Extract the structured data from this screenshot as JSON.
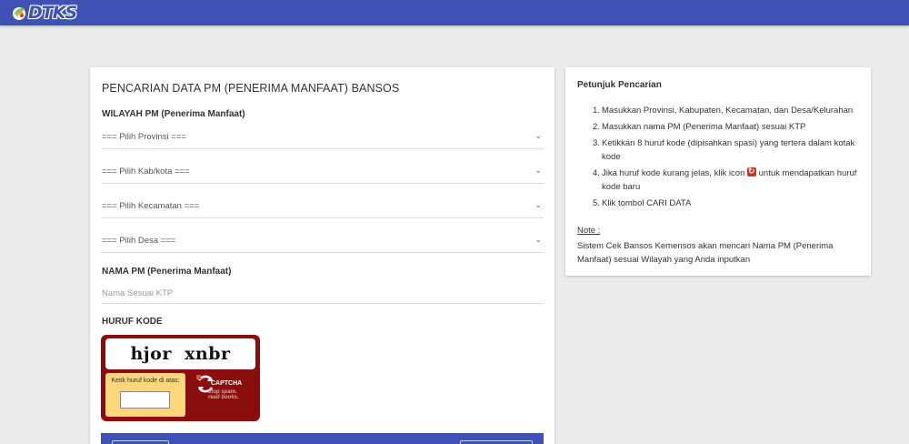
{
  "header": {
    "logo_text": "DTKS",
    "bar_color": "#3f51b5"
  },
  "form": {
    "title": "PENCARIAN DATA PM (PENERIMA MANFAAT) BANSOS",
    "wilayah_label": "WILAYAH PM (Penerima Manfaat)",
    "provinsi": "=== Pilih Provinsi ===",
    "kabkota": "=== Pilih Kab/kota ===",
    "kecamatan": "=== Pilih Kecamatan ===",
    "desa": "=== Pilih Desa ===",
    "nama_label": "NAMA PM (Penerima Manfaat)",
    "nama_placeholder": "Nama Sesuai KTP",
    "huruf_kode_label": "HURUF KODE"
  },
  "captcha": {
    "words": "hjor  xnbr",
    "input_label": "Ketik huruf kode di atas:",
    "brand": "CAPTCHA",
    "tagline_1": "stop spam.",
    "tagline_2": "read books.",
    "bg_color": "#8b0e0e"
  },
  "instructions": {
    "title": "Petunjuk Pencarian",
    "steps": [
      {
        "num": "1.",
        "text": "Masukkan Provinsi, Kabupaten, Kecamatan, dan Desa/Kelurahan"
      },
      {
        "num": "2.",
        "text": "Masukkan nama PM (Penerima Manfaat) sesuai KTP"
      },
      {
        "num": "3.",
        "text": "Ketikkan 8 huruf kode (dipisahkan spasi) yang tertera dalam kotak kode"
      },
      {
        "num": "4.",
        "text_before": "Jika huruf kode kurang jelas, klik icon",
        "text_after": "untuk mendapatkan huruf kode baru"
      },
      {
        "num": "5.",
        "text": "Klik tombol CARI DATA"
      }
    ],
    "note_label": "Note :",
    "note_text": "Sistem Cek Bansos Kemensos akan mencari Nama PM (Penerima Manfaat) sesuai Wilayah yang Anda inputkan"
  }
}
